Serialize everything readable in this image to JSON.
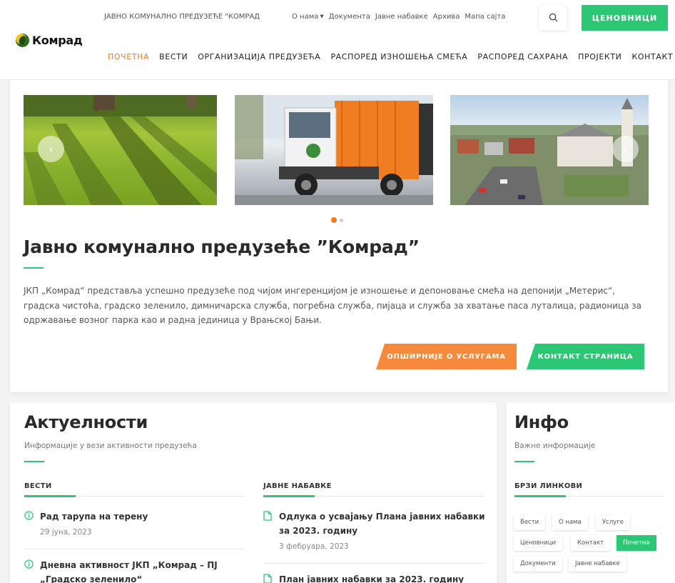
{
  "header": {
    "logo_text": "Комрад",
    "company_name": "ЈАВНО КОМУНАЛНО ПРЕДУЗЕЋЕ \"КОМРАД",
    "top_links": [
      "О нама",
      "Документа",
      "Јавне набавке",
      "Архива",
      "Мапа сајта"
    ],
    "price_button": "ЦЕНОВНИЦИ",
    "nav": [
      "ПОЧЕТНА",
      "ВЕСТИ",
      "ОРГАНИЗАЦИЈА ПРЕДУЗЕЋА",
      "РАСПОРЕД ИЗНОШЕЊА СМЕЋА",
      "РАСПОРЕД САХРАНА",
      "ПРОЈЕКТИ",
      "КОНТАКТ"
    ],
    "nav_active": "ПОЧЕТНА"
  },
  "hero": {
    "slider": {
      "slides": [
        "park-trees-image",
        "garbage-truck-image",
        "town-aerial-image"
      ],
      "active_index": 0,
      "dot_count": 2
    },
    "title": "Јавно комунално предузеће ”Комрад”",
    "description": "ЈКП „Комрад“ представља успешно предузеће под чијом ингеренцијом је изношење и депоновање смећа на депонији „Метерис“, градска чистоћа, градско зеленило, димничарска служба, погребна служба, пијаца и служба за хватање паса луталица, радионица за одржавање возног парка као и радна јединица у Врањској Бањи.",
    "button_services": "ОПШИРНИЈЕ О УСЛУГАМА",
    "button_contact": "КОНТАКТ СТРАНИЦА"
  },
  "news": {
    "title": "Актуелности",
    "subtitle": "Информације у вези активности предузећа",
    "vesti": {
      "heading": "ВЕСТИ",
      "items": [
        {
          "title": "Рад тарупа на терену",
          "date": "29 јуна, 2023"
        },
        {
          "title": "Дневна активност ЈКП „Комрад – ПЈ „Градско зеленило“",
          "date": ""
        }
      ]
    },
    "nabavke": {
      "heading": "ЈАВНЕ НАБАВКЕ",
      "items": [
        {
          "title": "Одлука о усвајању Плана јавних набавки за 2023. годину",
          "date": "3 фебруара, 2023"
        },
        {
          "title": "План јавних набавки за 2023. годину",
          "date": ""
        }
      ]
    }
  },
  "info": {
    "title": "Инфо",
    "subtitle": "Важне информације",
    "links_heading": "БРЗИ ЛИНКОВИ",
    "tags": [
      "Вести",
      "О нама",
      "Услуге",
      "Ценовници",
      "Контакт",
      "Почетна",
      "Документи",
      "Јавне набавке"
    ],
    "active_tag": "Почетна"
  },
  "colors": {
    "accent_green": "#2cc774",
    "accent_orange": "#f17a25"
  }
}
